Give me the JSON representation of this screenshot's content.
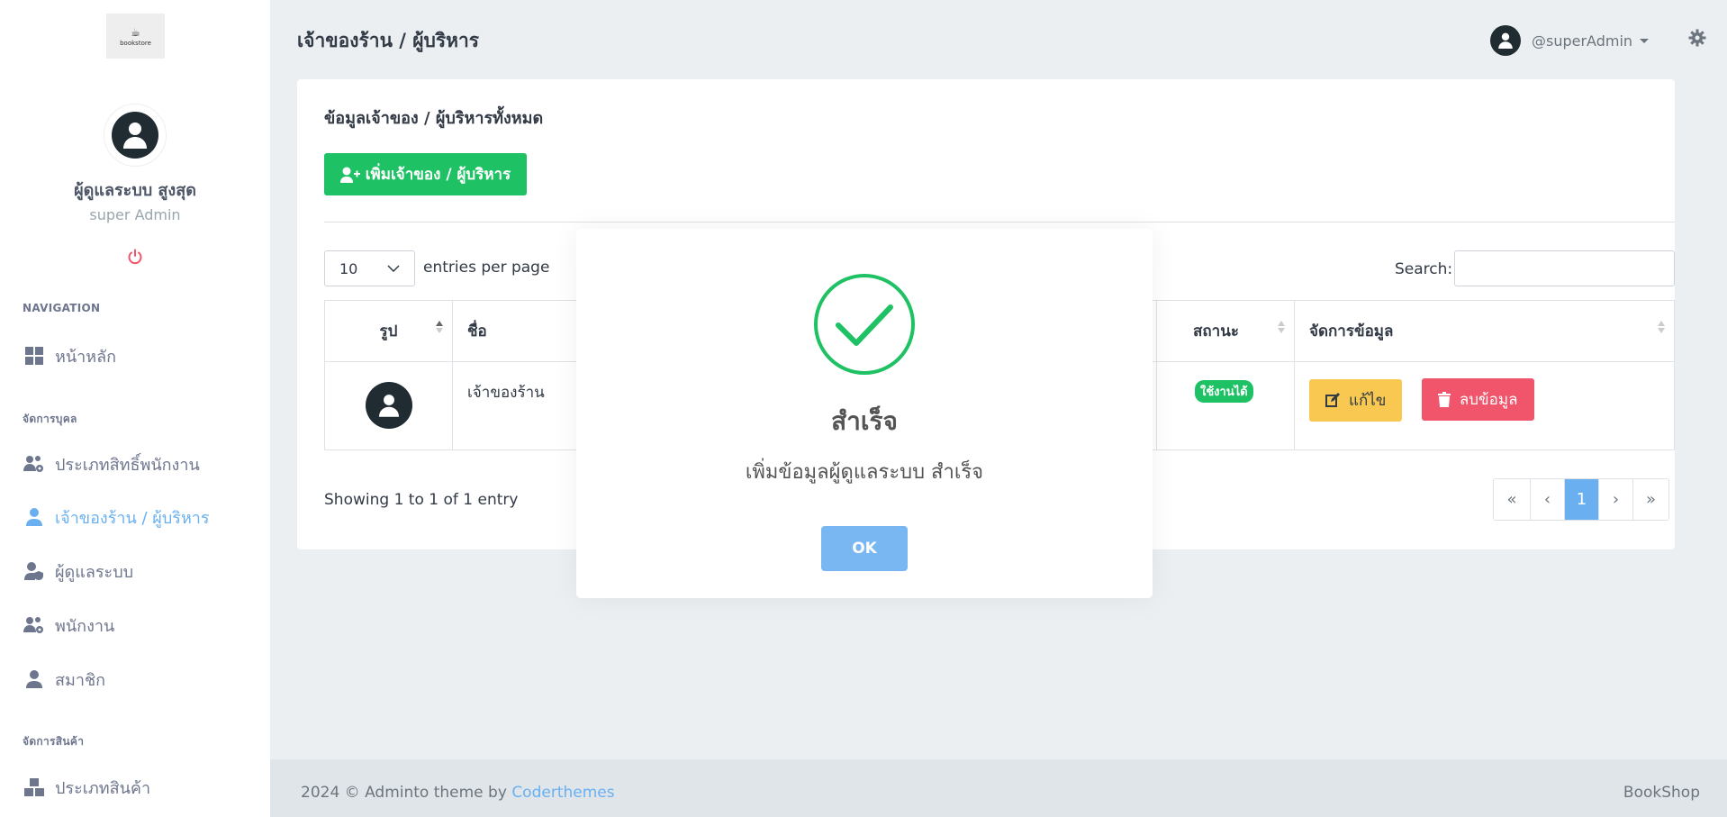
{
  "brand": {
    "logo_text": "bookstore",
    "logo_icon": "book-cup-icon"
  },
  "profile": {
    "name": "ผู้ดูแลระบบ สูงสุด",
    "role": "super Admin"
  },
  "nav": {
    "title_navigation": "NAVIGATION",
    "home": "หน้าหลัก",
    "title_people": "จัดการบุคล",
    "role_types": "ประเภทสิทธิ์พนักงาน",
    "owners": "เจ้าของร้าน / ผู้บริหาร",
    "admins": "ผู้ดูแลระบบ",
    "employees": "พนักงาน",
    "members": "สมาชิก",
    "title_products": "จัดการสินค้า",
    "product_types": "ประเภทสินค้า"
  },
  "header": {
    "title": "เจ้าของร้าน / ผู้บริหาร",
    "username": "@superAdmin"
  },
  "card": {
    "title": "ข้อมูลเจ้าของ / ผู้บริหารทั้งหมด",
    "add_button": "เพิ่มเจ้าของ / ผู้บริหาร",
    "per_page_value": "10",
    "per_page_label": "entries per page",
    "search_label": "Search:",
    "columns": {
      "photo": "รูป",
      "name": "ชื่อ",
      "status": "สถานะ",
      "manage": "จัดการข้อมูล"
    },
    "rows": [
      {
        "name": "เจ้าของร้าน",
        "status": "ใช้งานได้",
        "edit": "แก้ไข",
        "delete": "ลบข้อมูล"
      }
    ],
    "showing": "Showing 1 to 1 of 1 entry",
    "pager": {
      "first": "«",
      "prev": "‹",
      "current": "1",
      "next": "›",
      "last": "»"
    }
  },
  "footer": {
    "left": "2024 © Adminto theme by ",
    "link": "Coderthemes",
    "right": "BookShop"
  },
  "modal": {
    "title": "สำเร็จ",
    "message": "เพิ่มข้อมูลผู้ดูแลระบบ สำเร็จ",
    "ok": "OK"
  },
  "colors": {
    "success": "#1ec264",
    "primary": "#6ab0f0",
    "warning": "#f9c851",
    "danger": "#f1556c",
    "dark": "#212b32"
  }
}
